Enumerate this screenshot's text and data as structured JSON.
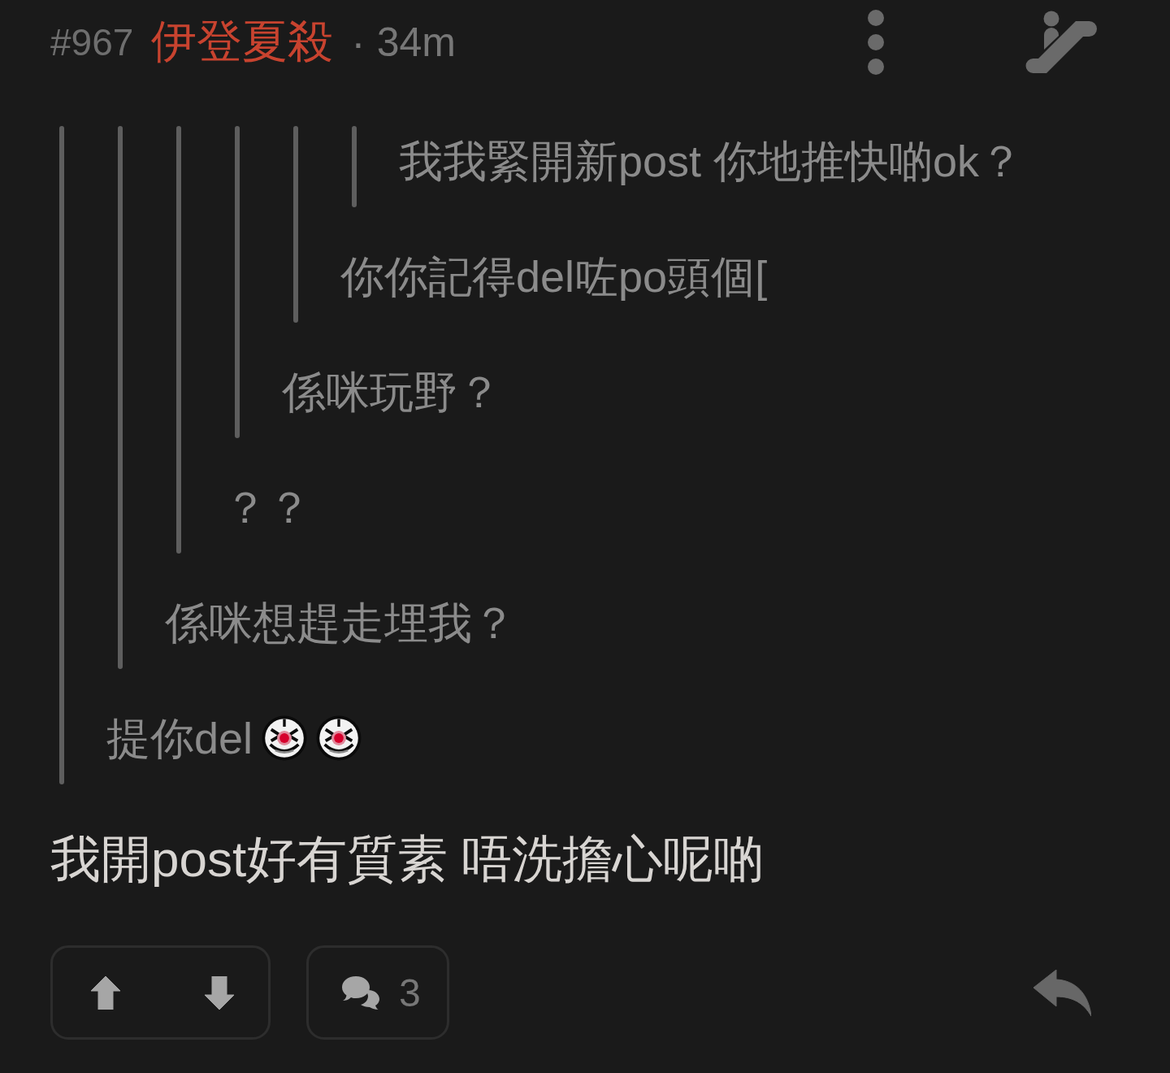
{
  "post": {
    "number": "#967",
    "author": "伊登夏殺",
    "separator": "·",
    "time": "34m"
  },
  "quote": {
    "quote": {
      "quote": {
        "quote": {
          "quote": {
            "quote": {
              "text": "我我緊開新post 你地推快啲ok？"
            },
            "text": "你你記得del咗po頭個["
          },
          "text": "係咪玩野？"
        },
        "text": "？？"
      },
      "text": "係咪想趕走埋我？"
    },
    "text": "提你del",
    "emoji": [
      {
        "kind": "clown"
      },
      {
        "kind": "clown"
      }
    ]
  },
  "body": "我開post好有質素 唔洗擔心呢啲",
  "actions": {
    "comment_count": "3"
  }
}
